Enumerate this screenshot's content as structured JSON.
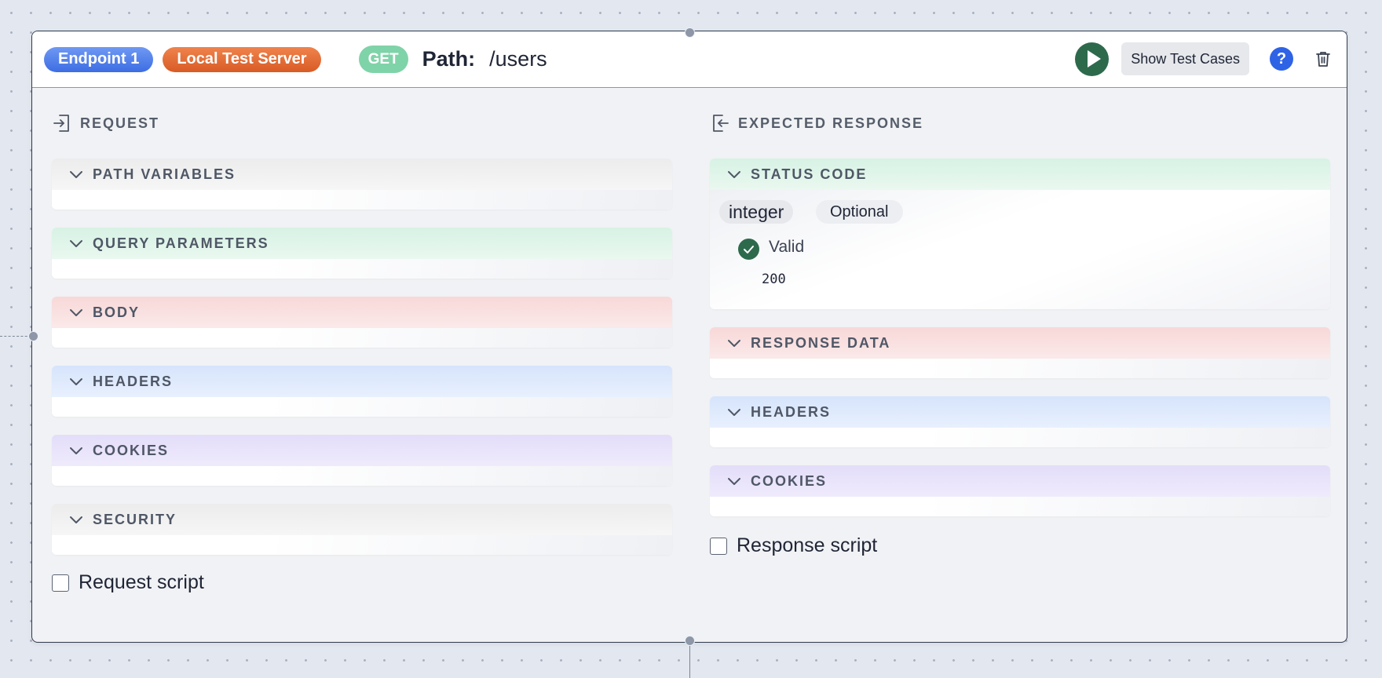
{
  "header": {
    "endpoint_label": "Endpoint 1",
    "server_label": "Local Test Server",
    "method": "GET",
    "path_label": "Path:",
    "path_value": "/users",
    "show_tests_label": "Show Test Cases",
    "help_glyph": "?",
    "colors": {
      "endpoint": "#4a78ea",
      "server": "#e2693a",
      "method": "#7fd3a8",
      "run": "#2d6a4c",
      "help": "#2e63e6"
    }
  },
  "request": {
    "title": "REQUEST",
    "icon": "sign-in-icon",
    "sections": [
      {
        "label": "PATH VARIABLES",
        "color": "gray"
      },
      {
        "label": "QUERY PARAMETERS",
        "color": "green"
      },
      {
        "label": "BODY",
        "color": "red"
      },
      {
        "label": "HEADERS",
        "color": "blue"
      },
      {
        "label": "COOKIES",
        "color": "purple"
      },
      {
        "label": "SECURITY",
        "color": "gray"
      }
    ],
    "script_label": "Request script",
    "script_checked": false
  },
  "response": {
    "title": "EXPECTED RESPONSE",
    "icon": "sign-out-icon",
    "status_code": {
      "label": "STATUS CODE",
      "type": "integer",
      "optional_label": "Optional",
      "valid_label": "Valid",
      "value": "200"
    },
    "sections": [
      {
        "label": "RESPONSE DATA",
        "color": "red"
      },
      {
        "label": "HEADERS",
        "color": "blue"
      },
      {
        "label": "COOKIES",
        "color": "purple"
      }
    ],
    "script_label": "Response script",
    "script_checked": false
  }
}
